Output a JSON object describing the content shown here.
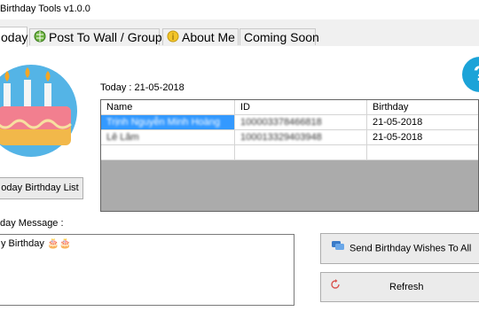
{
  "window": {
    "title": "Birthday Tools v1.0.0"
  },
  "tabs": [
    {
      "label": "oday",
      "icon": ""
    },
    {
      "label": "Post To Wall / Groups",
      "icon": "globe-icon"
    },
    {
      "label": "About Me",
      "icon": "info-icon"
    },
    {
      "label": "Coming Soon",
      "icon": ""
    }
  ],
  "today": {
    "label": "Today : 21-05-2018"
  },
  "table": {
    "columns": [
      "Name",
      "ID",
      "Birthday"
    ],
    "rows": [
      {
        "name": "Trịnh Nguyễn Minh Hoàng",
        "id": "100003378466818",
        "birthday": "21-05-2018"
      },
      {
        "name": "Lê Lâm",
        "id": "100013329403948",
        "birthday": "21-05-2018"
      }
    ]
  },
  "buttons": {
    "today_list": "oday Birthday List",
    "send_all": "Send Birthday Wishes To All",
    "refresh": "Refresh"
  },
  "message": {
    "label": "day Message :",
    "value": "y Birthday 🎂🎂"
  },
  "colors": {
    "accent": "#1ba3d8",
    "selection": "#3399ff",
    "grid_bg": "#ababab"
  }
}
